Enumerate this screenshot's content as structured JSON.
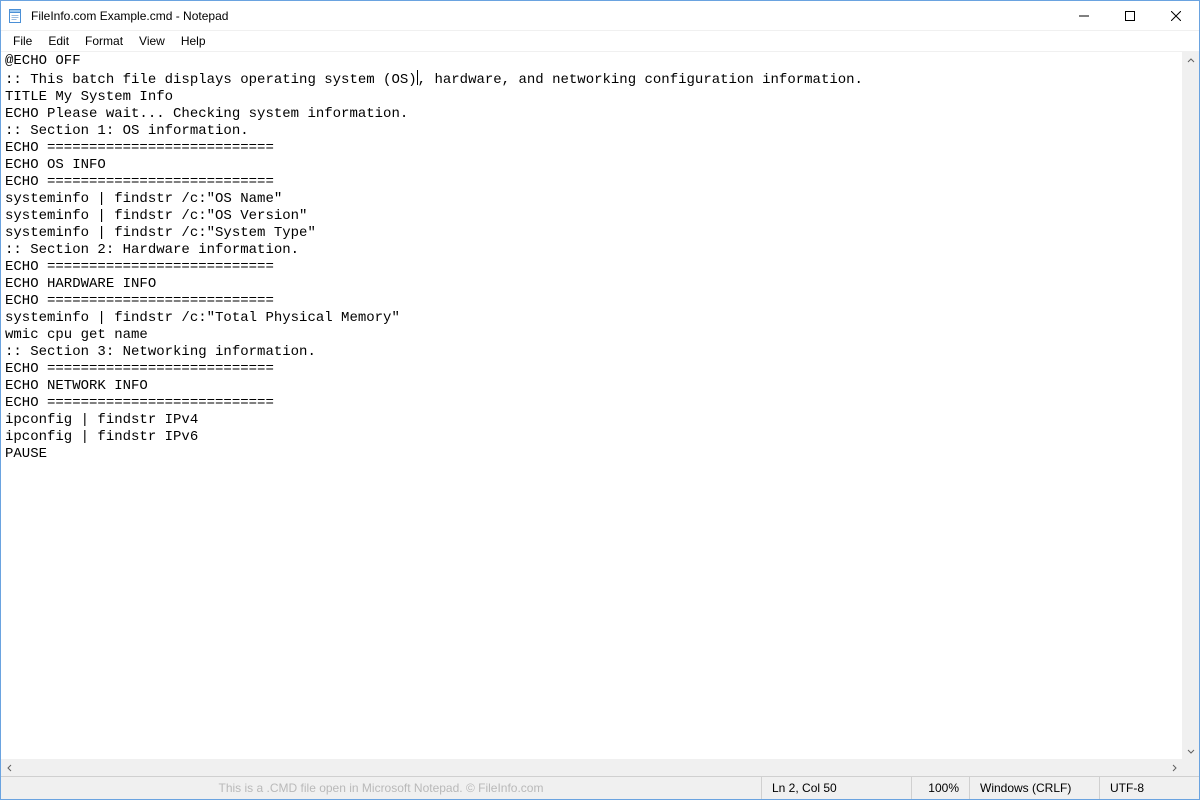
{
  "title": "FileInfo.com Example.cmd - Notepad",
  "menu": {
    "file": "File",
    "edit": "Edit",
    "format": "Format",
    "view": "View",
    "help": "Help"
  },
  "editor": {
    "lines": [
      "@ECHO OFF",
      ":: This batch file displays operating system (OS)",
      ", hardware, and networking configuration information.",
      "TITLE My System Info",
      "ECHO Please wait... Checking system information.",
      ":: Section 1: OS information.",
      "ECHO ===========================",
      "ECHO OS INFO",
      "ECHO ===========================",
      "systeminfo | findstr /c:\"OS Name\"",
      "systeminfo | findstr /c:\"OS Version\"",
      "systeminfo | findstr /c:\"System Type\"",
      ":: Section 2: Hardware information.",
      "ECHO ===========================",
      "ECHO HARDWARE INFO",
      "ECHO ===========================",
      "systeminfo | findstr /c:\"Total Physical Memory\"",
      "wmic cpu get name",
      ":: Section 3: Networking information.",
      "ECHO ===========================",
      "ECHO NETWORK INFO",
      "ECHO ===========================",
      "ipconfig | findstr IPv4",
      "ipconfig | findstr IPv6",
      "PAUSE"
    ]
  },
  "status": {
    "watermark": "This is a .CMD file open in Microsoft Notepad. © FileInfo.com",
    "position": "Ln 2, Col 50",
    "zoom": "100%",
    "eol": "Windows (CRLF)",
    "encoding": "UTF-8"
  }
}
